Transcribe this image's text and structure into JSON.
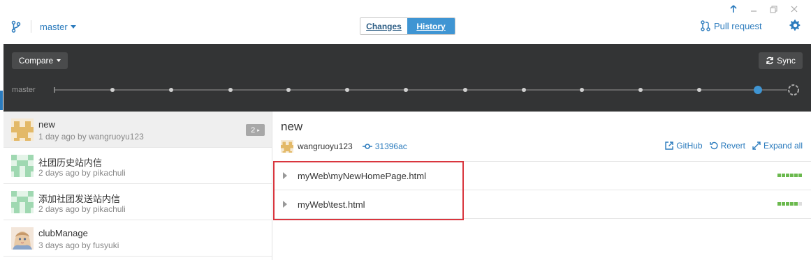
{
  "app": {
    "accent": "#2b7bbd"
  },
  "toolbar": {
    "branch": "master",
    "tabs": [
      {
        "label": "Changes"
      },
      {
        "label": "History"
      }
    ],
    "pull_request": "Pull request"
  },
  "timeline": {
    "compare_label": "Compare",
    "sync_label": "Sync",
    "branch_label": "master"
  },
  "commits": [
    {
      "title": "new",
      "meta": "1 day ago by wangruoyu123",
      "badge": "2"
    },
    {
      "title": "社团历史站内信",
      "meta": "2 days ago by pikachuli"
    },
    {
      "title": "添加社团发送站内信",
      "meta": "2 days ago by pikachuli"
    },
    {
      "title": "clubManage",
      "meta": "3 days ago by fusyuki"
    }
  ],
  "detail": {
    "title": "new",
    "author": "wangruoyu123",
    "sha": "31396ac",
    "actions": {
      "github": "GitHub",
      "revert": "Revert",
      "expand": "Expand all"
    },
    "files": [
      {
        "name": "myWeb\\myNewHomePage.html",
        "changes_filled": 6,
        "changes_total": 6
      },
      {
        "name": "myWeb\\test.html",
        "changes_filled": 5,
        "changes_total": 6
      }
    ]
  }
}
